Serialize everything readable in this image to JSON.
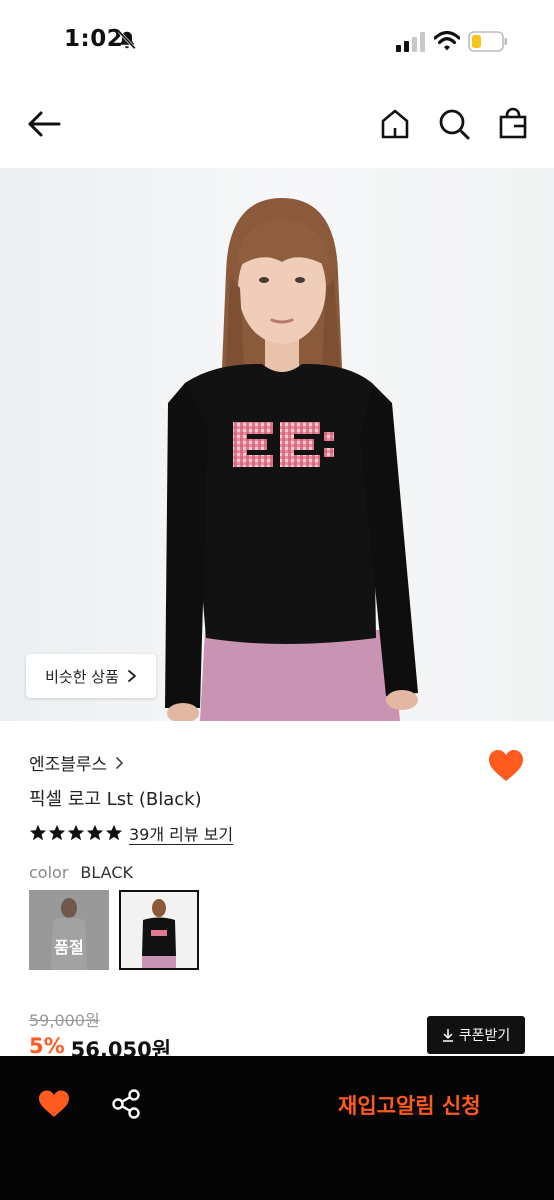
{
  "status_bar": {
    "time": "1:02"
  },
  "hero": {
    "similar_button": "비슷한 상품"
  },
  "product": {
    "brand": "엔조블루스",
    "name": "픽셀 로고 Lst (Black)",
    "rating_stars": 5,
    "review_link": "39개 리뷰 보기",
    "color_label": "color",
    "color_value": "BLACK",
    "sold_out_label": "품절",
    "original_price": "59,000원",
    "discount": "5%",
    "final_price": "56,050원",
    "coupon_button": "쿠폰받기"
  },
  "bottom_bar": {
    "restock_button": "재입고알림 신청"
  },
  "colors": {
    "accent": "#ff5a1f",
    "bar_bg": "#050505"
  },
  "icons": [
    "bell-slash-icon",
    "signal-icon",
    "wifi-icon",
    "battery-icon",
    "back-arrow-icon",
    "home-icon",
    "search-icon",
    "cart-icon",
    "chevron-right-icon",
    "heart-icon",
    "star-icon",
    "download-icon",
    "share-icon"
  ]
}
